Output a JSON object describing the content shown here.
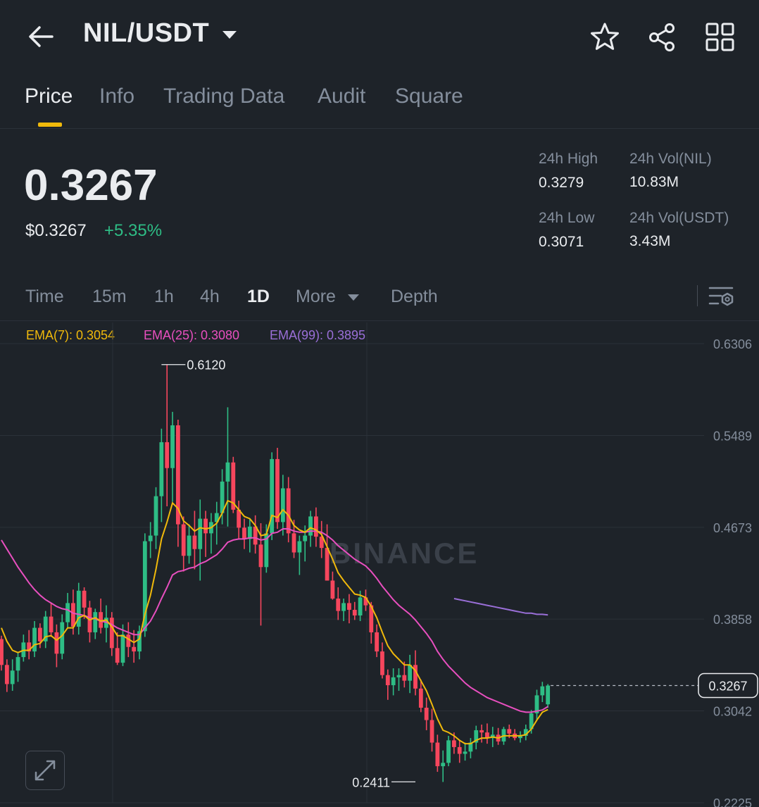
{
  "header": {
    "pair": "NIL/USDT",
    "icons": [
      "back-arrow-icon",
      "star-icon",
      "share-icon",
      "grid-icon"
    ]
  },
  "tabs": [
    {
      "label": "Price",
      "active": true
    },
    {
      "label": "Info"
    },
    {
      "label": "Trading Data"
    },
    {
      "label": "Audit"
    },
    {
      "label": "Square"
    }
  ],
  "ticker": {
    "price": "0.3267",
    "usd_price": "$0.3267",
    "change": "+5.35%",
    "high_label": "24h High",
    "high_value": "0.3279",
    "low_label": "24h Low",
    "low_value": "0.3071",
    "vol_base_label": "24h Vol(NIL)",
    "vol_base_value": "10.83M",
    "vol_quote_label": "24h Vol(USDT)",
    "vol_quote_value": "3.43M"
  },
  "intervals": [
    {
      "label": "Time"
    },
    {
      "label": "15m"
    },
    {
      "label": "1h"
    },
    {
      "label": "4h"
    },
    {
      "label": "1D",
      "active": true
    },
    {
      "label": "More"
    },
    {
      "label": "Depth"
    }
  ],
  "indicators": {
    "ema7": "EMA(7): 0.3054",
    "ema25": "EMA(25): 0.3080",
    "ema99": "EMA(99): 0.3895"
  },
  "colors": {
    "background": "#1e2329",
    "up": "#2ebd85",
    "down": "#f6465d",
    "accent": "#f0b90b",
    "ema7": "#f0b90b",
    "ema25": "#e84fbf",
    "ema99": "#9a6fd8"
  },
  "chart_data": {
    "type": "candlestick",
    "watermark": "BINANCE",
    "y_ticks": [
      "0.6306",
      "0.5489",
      "0.4673",
      "0.3858",
      "0.3042",
      "0.2225"
    ],
    "ylim": [
      0.2225,
      0.6306
    ],
    "current_price_label": "0.3267",
    "current_price": 0.3267,
    "high_marker": {
      "label": "0.6120",
      "value": 0.612,
      "index": 29
    },
    "low_marker": {
      "label": "0.2411",
      "value": 0.2411,
      "index": 75
    },
    "candles": [
      [
        0.368,
        0.371,
        0.34,
        0.345
      ],
      [
        0.345,
        0.35,
        0.321,
        0.328
      ],
      [
        0.328,
        0.35,
        0.322,
        0.34
      ],
      [
        0.34,
        0.356,
        0.33,
        0.352
      ],
      [
        0.352,
        0.372,
        0.348,
        0.365
      ],
      [
        0.365,
        0.376,
        0.35,
        0.357
      ],
      [
        0.357,
        0.384,
        0.352,
        0.378
      ],
      [
        0.378,
        0.382,
        0.36,
        0.366
      ],
      [
        0.366,
        0.393,
        0.36,
        0.388
      ],
      [
        0.388,
        0.4,
        0.37,
        0.374
      ],
      [
        0.374,
        0.381,
        0.343,
        0.355
      ],
      [
        0.355,
        0.39,
        0.35,
        0.383
      ],
      [
        0.383,
        0.409,
        0.378,
        0.4
      ],
      [
        0.4,
        0.412,
        0.372,
        0.379
      ],
      [
        0.379,
        0.418,
        0.372,
        0.411
      ],
      [
        0.411,
        0.414,
        0.386,
        0.396
      ],
      [
        0.396,
        0.402,
        0.365,
        0.374
      ],
      [
        0.374,
        0.395,
        0.368,
        0.392
      ],
      [
        0.392,
        0.404,
        0.373,
        0.378
      ],
      [
        0.378,
        0.398,
        0.365,
        0.387
      ],
      [
        0.387,
        0.392,
        0.353,
        0.36
      ],
      [
        0.36,
        0.374,
        0.345,
        0.347
      ],
      [
        0.347,
        0.381,
        0.344,
        0.372
      ],
      [
        0.372,
        0.383,
        0.352,
        0.361
      ],
      [
        0.361,
        0.376,
        0.347,
        0.357
      ],
      [
        0.357,
        0.38,
        0.35,
        0.375
      ],
      [
        0.375,
        0.462,
        0.37,
        0.455
      ],
      [
        0.455,
        0.472,
        0.44,
        0.46
      ],
      [
        0.46,
        0.503,
        0.448,
        0.495
      ],
      [
        0.495,
        0.555,
        0.472,
        0.543
      ],
      [
        0.543,
        0.612,
        0.486,
        0.52
      ],
      [
        0.52,
        0.57,
        0.49,
        0.558
      ],
      [
        0.558,
        0.563,
        0.45,
        0.47
      ],
      [
        0.47,
        0.477,
        0.428,
        0.442
      ],
      [
        0.442,
        0.47,
        0.435,
        0.46
      ],
      [
        0.46,
        0.482,
        0.43,
        0.448
      ],
      [
        0.448,
        0.492,
        0.42,
        0.475
      ],
      [
        0.475,
        0.482,
        0.441,
        0.462
      ],
      [
        0.462,
        0.48,
        0.444,
        0.472
      ],
      [
        0.472,
        0.49,
        0.452,
        0.48
      ],
      [
        0.48,
        0.519,
        0.47,
        0.508
      ],
      [
        0.508,
        0.574,
        0.468,
        0.525
      ],
      [
        0.525,
        0.53,
        0.48,
        0.483
      ],
      [
        0.483,
        0.491,
        0.457,
        0.467
      ],
      [
        0.467,
        0.475,
        0.448,
        0.457
      ],
      [
        0.457,
        0.475,
        0.445,
        0.468
      ],
      [
        0.468,
        0.478,
        0.444,
        0.452
      ],
      [
        0.452,
        0.471,
        0.38,
        0.432
      ],
      [
        0.432,
        0.47,
        0.427,
        0.462
      ],
      [
        0.462,
        0.534,
        0.456,
        0.528
      ],
      [
        0.528,
        0.538,
        0.466,
        0.472
      ],
      [
        0.472,
        0.514,
        0.46,
        0.502
      ],
      [
        0.502,
        0.512,
        0.454,
        0.462
      ],
      [
        0.462,
        0.474,
        0.44,
        0.445
      ],
      [
        0.445,
        0.46,
        0.425,
        0.455
      ],
      [
        0.455,
        0.469,
        0.437,
        0.46
      ],
      [
        0.46,
        0.482,
        0.45,
        0.477
      ],
      [
        0.477,
        0.485,
        0.45,
        0.459
      ],
      [
        0.459,
        0.473,
        0.44,
        0.449
      ],
      [
        0.449,
        0.47,
        0.42,
        0.42
      ],
      [
        0.42,
        0.428,
        0.403,
        0.404
      ],
      [
        0.404,
        0.414,
        0.385,
        0.393
      ],
      [
        0.393,
        0.404,
        0.384,
        0.4
      ],
      [
        0.4,
        0.408,
        0.382,
        0.394
      ],
      [
        0.394,
        0.401,
        0.385,
        0.389
      ],
      [
        0.389,
        0.411,
        0.384,
        0.405
      ],
      [
        0.405,
        0.412,
        0.393,
        0.398
      ],
      [
        0.398,
        0.401,
        0.364,
        0.374
      ],
      [
        0.374,
        0.381,
        0.352,
        0.357
      ],
      [
        0.357,
        0.365,
        0.333,
        0.336
      ],
      [
        0.336,
        0.341,
        0.314,
        0.327
      ],
      [
        0.327,
        0.342,
        0.318,
        0.334
      ],
      [
        0.334,
        0.342,
        0.322,
        0.336
      ],
      [
        0.336,
        0.348,
        0.325,
        0.331
      ],
      [
        0.331,
        0.354,
        0.32,
        0.345
      ],
      [
        0.345,
        0.358,
        0.318,
        0.324
      ],
      [
        0.324,
        0.332,
        0.303,
        0.307
      ],
      [
        0.307,
        0.316,
        0.287,
        0.296
      ],
      [
        0.296,
        0.306,
        0.268,
        0.276
      ],
      [
        0.276,
        0.283,
        0.25,
        0.255
      ],
      [
        0.255,
        0.269,
        0.241,
        0.258
      ],
      [
        0.258,
        0.282,
        0.255,
        0.278
      ],
      [
        0.278,
        0.285,
        0.266,
        0.272
      ],
      [
        0.272,
        0.278,
        0.258,
        0.266
      ],
      [
        0.266,
        0.276,
        0.26,
        0.268
      ],
      [
        0.268,
        0.28,
        0.262,
        0.276
      ],
      [
        0.276,
        0.291,
        0.27,
        0.287
      ],
      [
        0.287,
        0.292,
        0.276,
        0.285
      ],
      [
        0.285,
        0.293,
        0.275,
        0.28
      ],
      [
        0.28,
        0.29,
        0.272,
        0.283
      ],
      [
        0.283,
        0.289,
        0.274,
        0.277
      ],
      [
        0.277,
        0.29,
        0.274,
        0.288
      ],
      [
        0.288,
        0.292,
        0.28,
        0.284
      ],
      [
        0.284,
        0.288,
        0.278,
        0.28
      ],
      [
        0.28,
        0.286,
        0.276,
        0.282
      ],
      [
        0.282,
        0.292,
        0.278,
        0.288
      ],
      [
        0.288,
        0.305,
        0.284,
        0.302
      ],
      [
        0.302,
        0.323,
        0.296,
        0.318
      ],
      [
        0.318,
        0.33,
        0.312,
        0.326
      ],
      [
        0.31,
        0.328,
        0.307,
        0.3267
      ]
    ],
    "ema7": [
      0.378,
      0.366,
      0.358,
      0.356,
      0.358,
      0.358,
      0.363,
      0.364,
      0.37,
      0.371,
      0.367,
      0.371,
      0.378,
      0.378,
      0.387,
      0.389,
      0.385,
      0.387,
      0.384,
      0.385,
      0.379,
      0.371,
      0.371,
      0.368,
      0.365,
      0.368,
      0.39,
      0.407,
      0.43,
      0.457,
      0.472,
      0.489,
      0.484,
      0.473,
      0.469,
      0.464,
      0.467,
      0.466,
      0.467,
      0.471,
      0.48,
      0.491,
      0.489,
      0.483,
      0.477,
      0.475,
      0.469,
      0.46,
      0.461,
      0.478,
      0.476,
      0.483,
      0.478,
      0.469,
      0.465,
      0.463,
      0.467,
      0.465,
      0.461,
      0.45,
      0.439,
      0.427,
      0.42,
      0.414,
      0.408,
      0.407,
      0.405,
      0.397,
      0.387,
      0.374,
      0.362,
      0.355,
      0.35,
      0.345,
      0.345,
      0.34,
      0.331,
      0.322,
      0.31,
      0.297,
      0.287,
      0.285,
      0.282,
      0.278,
      0.275,
      0.275,
      0.278,
      0.28,
      0.28,
      0.281,
      0.28,
      0.282,
      0.282,
      0.282,
      0.282,
      0.283,
      0.288,
      0.296,
      0.303,
      0.3054
    ],
    "ema25": [
      0.456,
      0.448,
      0.44,
      0.432,
      0.425,
      0.418,
      0.412,
      0.407,
      0.403,
      0.4,
      0.397,
      0.395,
      0.394,
      0.391,
      0.39,
      0.389,
      0.387,
      0.386,
      0.384,
      0.383,
      0.381,
      0.378,
      0.376,
      0.374,
      0.372,
      0.372,
      0.378,
      0.384,
      0.393,
      0.404,
      0.414,
      0.425,
      0.428,
      0.429,
      0.431,
      0.432,
      0.435,
      0.437,
      0.44,
      0.443,
      0.448,
      0.454,
      0.456,
      0.457,
      0.457,
      0.458,
      0.458,
      0.456,
      0.457,
      0.462,
      0.463,
      0.466,
      0.466,
      0.464,
      0.463,
      0.463,
      0.464,
      0.464,
      0.463,
      0.46,
      0.456,
      0.451,
      0.447,
      0.443,
      0.439,
      0.436,
      0.433,
      0.428,
      0.422,
      0.415,
      0.409,
      0.403,
      0.398,
      0.394,
      0.39,
      0.385,
      0.379,
      0.373,
      0.366,
      0.357,
      0.35,
      0.344,
      0.339,
      0.334,
      0.329,
      0.325,
      0.322,
      0.319,
      0.316,
      0.314,
      0.312,
      0.31,
      0.308,
      0.306,
      0.304,
      0.303,
      0.303,
      0.304,
      0.305,
      0.308
    ],
    "ema99_start": 82,
    "ema99": [
      0.404,
      0.403,
      0.402,
      0.401,
      0.4,
      0.399,
      0.398,
      0.397,
      0.396,
      0.395,
      0.394,
      0.393,
      0.392,
      0.391,
      0.391,
      0.39,
      0.39,
      0.3895
    ]
  },
  "controls": {
    "expand_icon": "expand-icon",
    "settings_icon": "chart-settings-icon"
  }
}
